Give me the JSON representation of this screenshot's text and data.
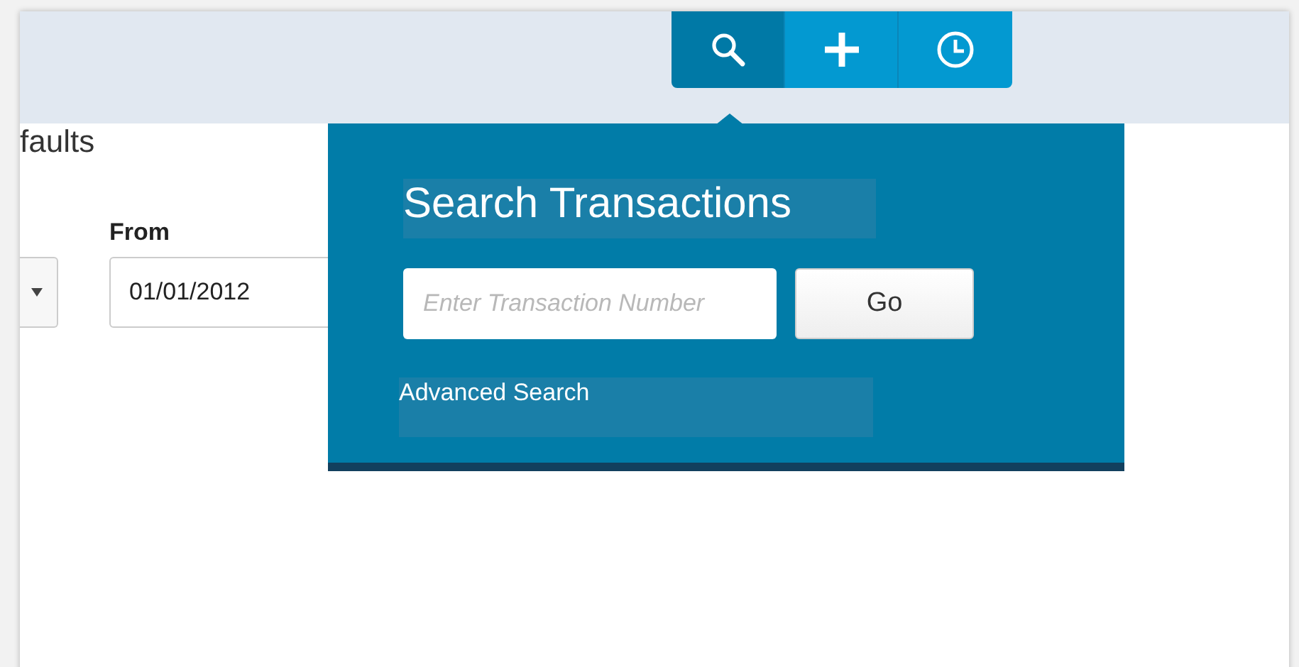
{
  "toolbar": [
    {
      "kind": "search",
      "selected": true
    },
    {
      "kind": "add",
      "selected": false
    },
    {
      "kind": "history",
      "selected": false
    }
  ],
  "page": {
    "heading": "faults",
    "from_label": "From",
    "from_value": "01/01/2012"
  },
  "popover": {
    "title": "Search Transactions",
    "search": {
      "placeholder": "Enter Transaction Number"
    },
    "go_button": "Go",
    "advanced_link": "Advanced Search"
  }
}
